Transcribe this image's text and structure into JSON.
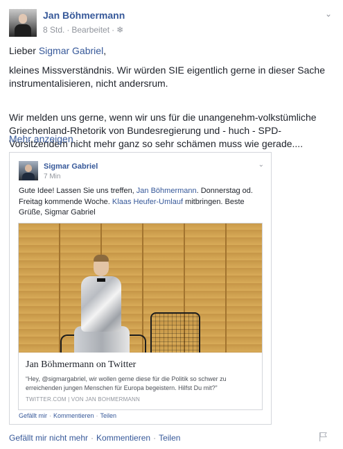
{
  "post": {
    "author": "Jan Böhmermann",
    "time": "8 Std.",
    "edited": "Bearbeitet",
    "paragraph1_prefix": "Lieber ",
    "paragraph1_link": "Sigmar Gabriel",
    "paragraph1_suffix": ",",
    "paragraph2": "kleines Missverständnis. Wir würden SIE eigentlich gerne in dieser Sache instrumentalisieren, nicht andersrum.",
    "paragraph3": "Wir melden uns gerne, wenn wir uns für die unangenehm-volkstümliche Griechenland-Rhetorik von Bundesregierung und - huch - SPD-Vorsitzendem nicht mehr ganz so sehr schämen muss wie gerade....",
    "more": "Mehr anzeigen"
  },
  "shared": {
    "author": "Sigmar Gabriel",
    "time": "7 Min",
    "text_part1": "Gute Idee! Lassen Sie uns treffen, ",
    "text_link1": "Jan Böhmermann",
    "text_part2": ". Donnerstag od. Freitag kommende Woche. ",
    "text_link2": "Klaas Heufer-Umlauf",
    "text_part3": " mitbringen. Beste Grüße, Sigmar Gabriel",
    "link_title": "Jan Böhmermann on Twitter",
    "link_desc": "“Hey, @sigmargabriel, wir wollen gerne diese für die Politik so schwer zu erreichenden jungen Menschen für Europa begeistern. Hilfst Du mit?”",
    "link_source": "TWITTER.COM",
    "link_source_sep": "|",
    "link_source_by": "VON JAN BOHMERMANN",
    "actions": [
      "Gefällt mir",
      "Kommentieren",
      "Teilen"
    ]
  },
  "actions": [
    "Gefällt mir nicht mehr",
    "Kommentieren",
    "Teilen"
  ],
  "colors": {
    "link": "#365899",
    "text": "#1d2129",
    "meta": "#90949c"
  },
  "icons": [
    "chevron-down-icon",
    "globe-icon",
    "flag-icon"
  ]
}
